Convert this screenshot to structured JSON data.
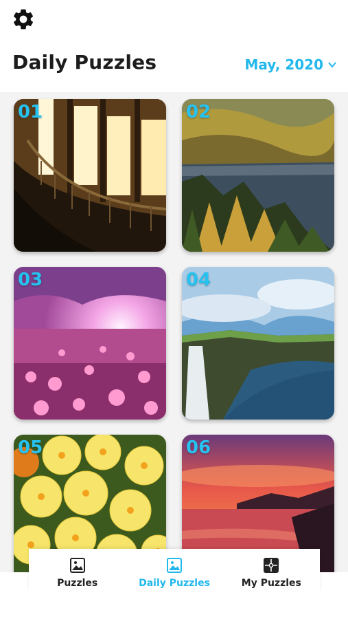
{
  "header": {
    "title": "Daily Puzzles",
    "month": "May, 2020"
  },
  "puzzles": [
    {
      "number": "01",
      "subject": "staircase-windows"
    },
    {
      "number": "02",
      "subject": "mountain-lake-forest"
    },
    {
      "number": "03",
      "subject": "pink-flower-field"
    },
    {
      "number": "04",
      "subject": "sea-cliffs"
    },
    {
      "number": "05",
      "subject": "yellow-primroses"
    },
    {
      "number": "06",
      "subject": "sunset-lake"
    }
  ],
  "tabs": [
    {
      "label": "Puzzles",
      "icon": "image-icon",
      "active": false
    },
    {
      "label": "Daily Puzzles",
      "icon": "image-icon",
      "active": true
    },
    {
      "label": "My Puzzles",
      "icon": "puzzle-piece-icon",
      "active": false
    }
  ],
  "colors": {
    "accent": "#21b8ec",
    "title": "#1d1d1d",
    "background": "#f3f3f3"
  }
}
